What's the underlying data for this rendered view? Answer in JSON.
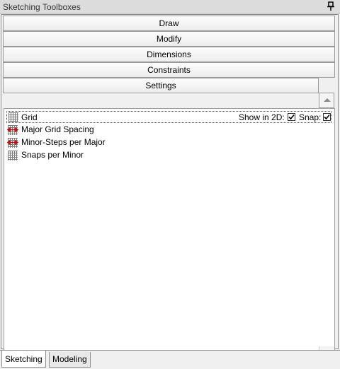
{
  "window": {
    "title": "Sketching Toolboxes",
    "pin_icon": "pin-icon"
  },
  "sections": {
    "draw": "Draw",
    "modify": "Modify",
    "dimensions": "Dimensions",
    "constraints": "Constraints",
    "settings": "Settings"
  },
  "settings_panel": {
    "grid": {
      "label": "Grid",
      "show_in_2d_label": "Show in 2D:",
      "show_in_2d_checked": true,
      "snap_label": "Snap:",
      "snap_checked": true
    },
    "items": [
      {
        "label": "Major Grid Spacing",
        "icon": "grid-spacing-icon"
      },
      {
        "label": "Minor-Steps per Major",
        "icon": "grid-spacing-icon"
      },
      {
        "label": "Snaps per Minor",
        "icon": "grid-icon"
      }
    ]
  },
  "tabs": {
    "sketching": "Sketching",
    "modeling": "Modeling",
    "active": "Sketching"
  },
  "colors": {
    "grid_icon_stroke": "#7a7a7a",
    "spacing_arrow": "#cc0000"
  }
}
